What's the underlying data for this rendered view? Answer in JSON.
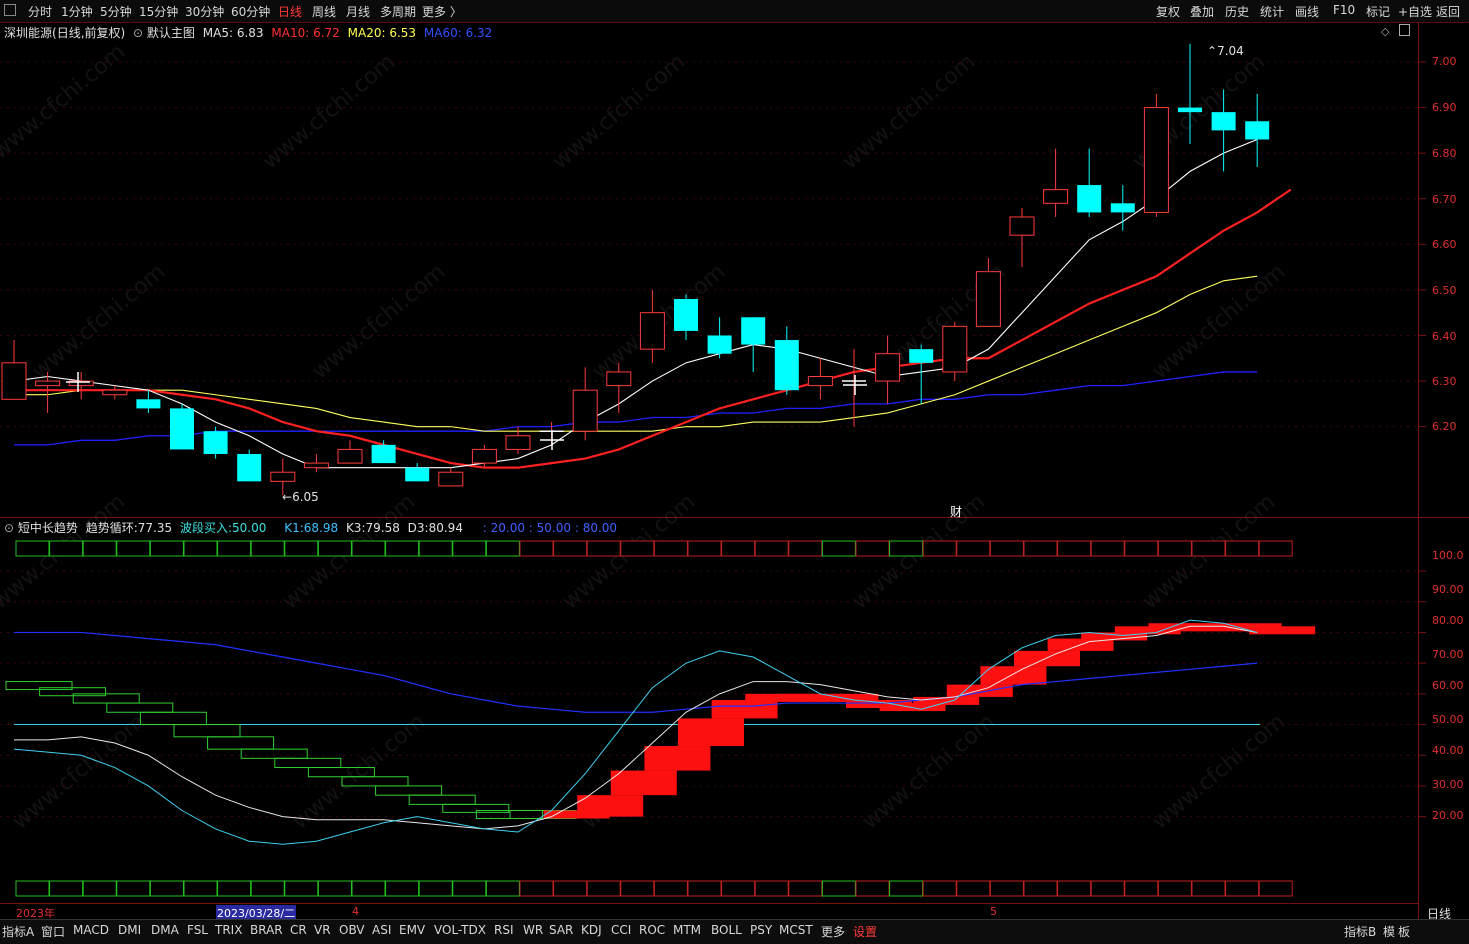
{
  "toolbar": {
    "periods": [
      "分时",
      "1分钟",
      "5分钟",
      "15分钟",
      "30分钟",
      "60分钟",
      "日线",
      "周线",
      "月线",
      "多周期",
      "更多 〉"
    ],
    "active_period": "日线",
    "right_buttons": [
      "复权",
      "叠加",
      "历史",
      "统计",
      "画线",
      "F10",
      "标记",
      "+自选",
      "返回"
    ]
  },
  "main_header": {
    "stock": "深圳能源",
    "mode": "(日线,前复权)",
    "template": "默认主图",
    "ma5_label": "MA5:",
    "ma5": "6.83",
    "ma10_label": "MA10:",
    "ma10": "6.72",
    "ma20_label": "MA20:",
    "ma20": "6.53",
    "ma60_label": "MA60:",
    "ma60": "6.32"
  },
  "colors": {
    "up": "#ff3b3b",
    "down": "#00ffff",
    "ma5": "#ffffff",
    "ma10": "#ff2020",
    "ma20": "#ffff60",
    "ma60": "#2020ff",
    "axis": "#e03030"
  },
  "price_axis": [
    "7.00",
    "6.90",
    "6.80",
    "6.70",
    "6.60",
    "6.50",
    "6.40",
    "6.30",
    "6.20"
  ],
  "annotations": {
    "high": "7.04",
    "low": "6.05",
    "fin": "财"
  },
  "sub_header": {
    "name": "短中长趋势",
    "trend_label": "趋势循环:",
    "trend": "77.35",
    "buy_label": "波段买入:",
    "buy": "50.00",
    "k1_label": "K1:",
    "k1": "68.98",
    "k3_label": "K3:",
    "k3": "79.58",
    "d3_label": "D3:",
    "d3": "80.94",
    "levels": ": 20.00 : 50.00 : 80.00"
  },
  "sub_axis": [
    "100.0",
    "90.00",
    "80.00",
    "70.00",
    "60.00",
    "50.00",
    "40.00",
    "30.00",
    "20.00"
  ],
  "date_axis": {
    "year": "2023年",
    "cursor_date": "2023/03/28/二",
    "m4": "4",
    "m5": "5",
    "period": "日线"
  },
  "bottom_tabs": [
    "指标A",
    "窗口",
    "MACD",
    "DMI",
    "DMA",
    "FSL",
    "TRIX",
    "BRAR",
    "CR",
    "VR",
    "OBV",
    "ASI",
    "EMV",
    "VOL-TDX",
    "RSI",
    "WR",
    "SAR",
    "KDJ",
    "CCI",
    "ROC",
    "MTM",
    "BOLL",
    "PSY",
    "MCST",
    "更多",
    "设置"
  ],
  "bottom_right": [
    "指标B",
    "模",
    "板"
  ],
  "watermark": "www.cfchi.com",
  "chart_data": {
    "type": "candlestick",
    "ylim": [
      6.0,
      7.1
    ],
    "candles": [
      {
        "o": 6.26,
        "c": 6.34,
        "h": 6.39,
        "l": 6.26
      },
      {
        "o": 6.29,
        "c": 6.3,
        "h": 6.32,
        "l": 6.23
      },
      {
        "o": 6.29,
        "c": 6.3,
        "h": 6.32,
        "l": 6.26
      },
      {
        "o": 6.27,
        "c": 6.28,
        "h": 6.29,
        "l": 6.26
      },
      {
        "o": 6.26,
        "c": 6.24,
        "h": 6.28,
        "l": 6.23
      },
      {
        "o": 6.24,
        "c": 6.15,
        "h": 6.25,
        "l": 6.15
      },
      {
        "o": 6.19,
        "c": 6.14,
        "h": 6.2,
        "l": 6.13
      },
      {
        "o": 6.14,
        "c": 6.08,
        "h": 6.15,
        "l": 6.08
      },
      {
        "o": 6.08,
        "c": 6.1,
        "h": 6.13,
        "l": 6.05
      },
      {
        "o": 6.11,
        "c": 6.12,
        "h": 6.14,
        "l": 6.1
      },
      {
        "o": 6.12,
        "c": 6.15,
        "h": 6.17,
        "l": 6.12
      },
      {
        "o": 6.16,
        "c": 6.12,
        "h": 6.17,
        "l": 6.12
      },
      {
        "o": 6.11,
        "c": 6.08,
        "h": 6.12,
        "l": 6.08
      },
      {
        "o": 6.07,
        "c": 6.1,
        "h": 6.11,
        "l": 6.07
      },
      {
        "o": 6.12,
        "c": 6.15,
        "h": 6.16,
        "l": 6.11
      },
      {
        "o": 6.15,
        "c": 6.18,
        "h": 6.2,
        "l": 6.14
      },
      {
        "o": 6.19,
        "c": 6.19,
        "h": 6.21,
        "l": 6.16
      },
      {
        "o": 6.19,
        "c": 6.28,
        "h": 6.33,
        "l": 6.17
      },
      {
        "o": 6.29,
        "c": 6.32,
        "h": 6.34,
        "l": 6.23
      },
      {
        "o": 6.37,
        "c": 6.45,
        "h": 6.5,
        "l": 6.34
      },
      {
        "o": 6.48,
        "c": 6.41,
        "h": 6.49,
        "l": 6.39
      },
      {
        "o": 6.4,
        "c": 6.36,
        "h": 6.44,
        "l": 6.35
      },
      {
        "o": 6.44,
        "c": 6.38,
        "h": 6.44,
        "l": 6.32
      },
      {
        "o": 6.39,
        "c": 6.28,
        "h": 6.42,
        "l": 6.27
      },
      {
        "o": 6.29,
        "c": 6.31,
        "h": 6.35,
        "l": 6.26
      },
      {
        "o": 6.3,
        "c": 6.3,
        "h": 6.37,
        "l": 6.2
      },
      {
        "o": 6.3,
        "c": 6.36,
        "h": 6.4,
        "l": 6.25
      },
      {
        "o": 6.37,
        "c": 6.34,
        "h": 6.38,
        "l": 6.25
      },
      {
        "o": 6.32,
        "c": 6.42,
        "h": 6.43,
        "l": 6.3
      },
      {
        "o": 6.42,
        "c": 6.54,
        "h": 6.57,
        "l": 6.42
      },
      {
        "o": 6.62,
        "c": 6.66,
        "h": 6.68,
        "l": 6.55
      },
      {
        "o": 6.69,
        "c": 6.72,
        "h": 6.81,
        "l": 6.66
      },
      {
        "o": 6.73,
        "c": 6.67,
        "h": 6.81,
        "l": 6.66
      },
      {
        "o": 6.69,
        "c": 6.67,
        "h": 6.73,
        "l": 6.63
      },
      {
        "o": 6.67,
        "c": 6.9,
        "h": 6.93,
        "l": 6.66
      },
      {
        "o": 6.9,
        "c": 6.89,
        "h": 7.04,
        "l": 6.82
      },
      {
        "o": 6.89,
        "c": 6.85,
        "h": 6.94,
        "l": 6.76
      },
      {
        "o": 6.87,
        "c": 6.83,
        "h": 6.93,
        "l": 6.77
      }
    ],
    "ma5": [
      6.3,
      6.31,
      6.3,
      6.29,
      6.28,
      6.25,
      6.21,
      6.18,
      6.14,
      6.11,
      6.11,
      6.11,
      6.11,
      6.11,
      6.12,
      6.13,
      6.16,
      6.21,
      6.25,
      6.3,
      6.34,
      6.36,
      6.38,
      6.37,
      6.35,
      6.33,
      6.31,
      6.32,
      6.33,
      6.37,
      6.45,
      6.53,
      6.61,
      6.65,
      6.7,
      6.76,
      6.8,
      6.83
    ],
    "ma10": [
      6.28,
      6.28,
      6.28,
      6.28,
      6.28,
      6.27,
      6.26,
      6.24,
      6.21,
      6.19,
      6.18,
      6.16,
      6.14,
      6.12,
      6.11,
      6.11,
      6.12,
      6.13,
      6.15,
      6.18,
      6.21,
      6.24,
      6.26,
      6.28,
      6.3,
      6.32,
      6.33,
      6.34,
      6.35,
      6.35,
      6.39,
      6.43,
      6.47,
      6.5,
      6.53,
      6.58,
      6.63,
      6.67,
      6.72
    ],
    "ma20": [
      6.27,
      6.27,
      6.28,
      6.28,
      6.28,
      6.28,
      6.27,
      6.26,
      6.25,
      6.24,
      6.22,
      6.21,
      6.2,
      6.2,
      6.19,
      6.19,
      6.19,
      6.19,
      6.19,
      6.19,
      6.2,
      6.2,
      6.21,
      6.21,
      6.21,
      6.22,
      6.23,
      6.25,
      6.27,
      6.3,
      6.33,
      6.36,
      6.39,
      6.42,
      6.45,
      6.49,
      6.52,
      6.53
    ],
    "ma60": [
      6.16,
      6.16,
      6.17,
      6.17,
      6.18,
      6.18,
      6.19,
      6.19,
      6.19,
      6.19,
      6.19,
      6.19,
      6.19,
      6.19,
      6.19,
      6.2,
      6.2,
      6.21,
      6.21,
      6.22,
      6.22,
      6.23,
      6.23,
      6.24,
      6.24,
      6.25,
      6.25,
      6.26,
      6.26,
      6.27,
      6.27,
      6.28,
      6.29,
      6.29,
      6.3,
      6.31,
      6.32,
      6.32
    ],
    "sub": {
      "ylim": [
        0,
        105
      ],
      "k1": [
        42,
        41,
        40,
        36,
        30,
        22,
        16,
        12,
        11,
        12,
        15,
        18,
        20,
        18,
        16,
        15,
        22,
        34,
        48,
        62,
        70,
        74,
        72,
        66,
        60,
        58,
        57,
        55,
        58,
        68,
        75,
        79,
        80,
        79,
        80,
        84,
        83,
        80
      ],
      "k3": [
        45,
        45,
        46,
        44,
        40,
        33,
        27,
        23,
        20,
        19,
        19,
        19,
        18,
        17,
        16,
        17,
        20,
        26,
        34,
        44,
        54,
        60,
        64,
        64,
        63,
        61,
        59,
        58,
        59,
        62,
        68,
        73,
        77,
        78,
        79,
        82,
        82,
        80
      ],
      "d3": [
        80,
        80,
        80,
        79,
        78,
        77,
        76,
        74,
        72,
        70,
        68,
        66,
        63,
        60,
        58,
        56,
        55,
        54,
        54,
        54,
        55,
        56,
        56,
        57,
        57,
        57,
        57,
        58,
        59,
        61,
        63,
        64,
        65,
        66,
        67,
        68,
        69,
        70
      ],
      "buy_line": 50,
      "trend_steps": [
        64,
        62,
        60,
        57,
        54,
        50,
        46,
        42,
        39,
        36,
        33,
        30,
        27,
        24,
        22,
        22,
        22,
        20,
        27,
        35,
        43,
        52,
        58,
        60,
        60,
        58,
        57,
        57,
        59,
        63,
        69,
        74,
        78,
        80,
        82,
        83,
        83,
        82,
        82
      ]
    }
  }
}
